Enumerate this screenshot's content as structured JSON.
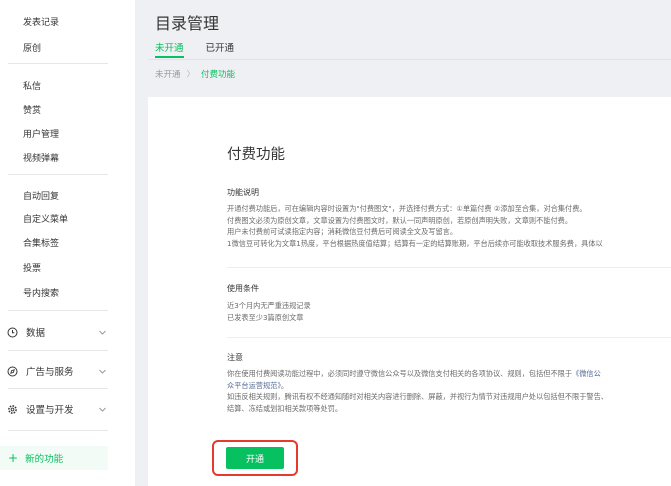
{
  "sidebar": {
    "top_items": [
      "发表记录",
      "原创"
    ],
    "items_a": [
      "私信",
      "赞赏",
      "用户管理",
      "视频弹幕"
    ],
    "items_b": [
      "自动回复",
      "自定义菜单",
      "合集标签",
      "投票",
      "号内搜索"
    ],
    "groups": [
      {
        "label": "数据",
        "icon": "clock-icon"
      },
      {
        "label": "广告与服务",
        "icon": "compass-icon"
      },
      {
        "label": "设置与开发",
        "icon": "gear-icon"
      }
    ],
    "new_feature": "新的功能"
  },
  "header": {
    "title": "目录管理",
    "tabs": [
      {
        "label": "未开通",
        "active": true
      },
      {
        "label": "已开通",
        "active": false
      }
    ]
  },
  "breadcrumb": {
    "parent": "未开通",
    "separator": "〉",
    "current": "付费功能"
  },
  "main": {
    "title": "付费功能",
    "sections": [
      {
        "heading": "功能说明",
        "lines": [
          "开通付费功能后，可在编辑内容时设置为\"付费图文\"，并选择付费方式：①单篇付费 ②添加至合集，对合集付费。",
          "付费图文必须为原创文章，文章设置为付费图文时，默认一同声明原创，若原创声明失败，文章则不能付费。",
          "用户未付费前可试读指定内容；消耗微信豆付费后可阅读全文及写留言。",
          "1微信豆可转化为文章1热度，平台根据热度值结算；结算有一定的结算账期，平台后续亦可能收取技术服务费，具体以"
        ]
      },
      {
        "heading": "使用条件",
        "lines": [
          "近3个月内无严重违规记录",
          "已发表至少3篇原创文章"
        ]
      },
      {
        "heading": "注意",
        "line1_text": "你在使用付费阅读功能过程中，必须同时遵守微信公众号以及微信支付相关的各项协议、规则，包括但不限于",
        "line1_link": "《微信公",
        "line2_link": "众平台运营规范》",
        "line2_text": "。",
        "line3": "如违反相关规则，腾讯有权不经通知随时对相关内容进行删除、屏蔽，并视行为情节对违规用户处以包括但不限于警告、",
        "line4": "结算、冻结或划扣相关款项等处罚。"
      }
    ],
    "open_button": "开通"
  },
  "colors": {
    "accent": "#07c160",
    "highlight_frame": "#e33b2e",
    "link": "#576b95"
  }
}
